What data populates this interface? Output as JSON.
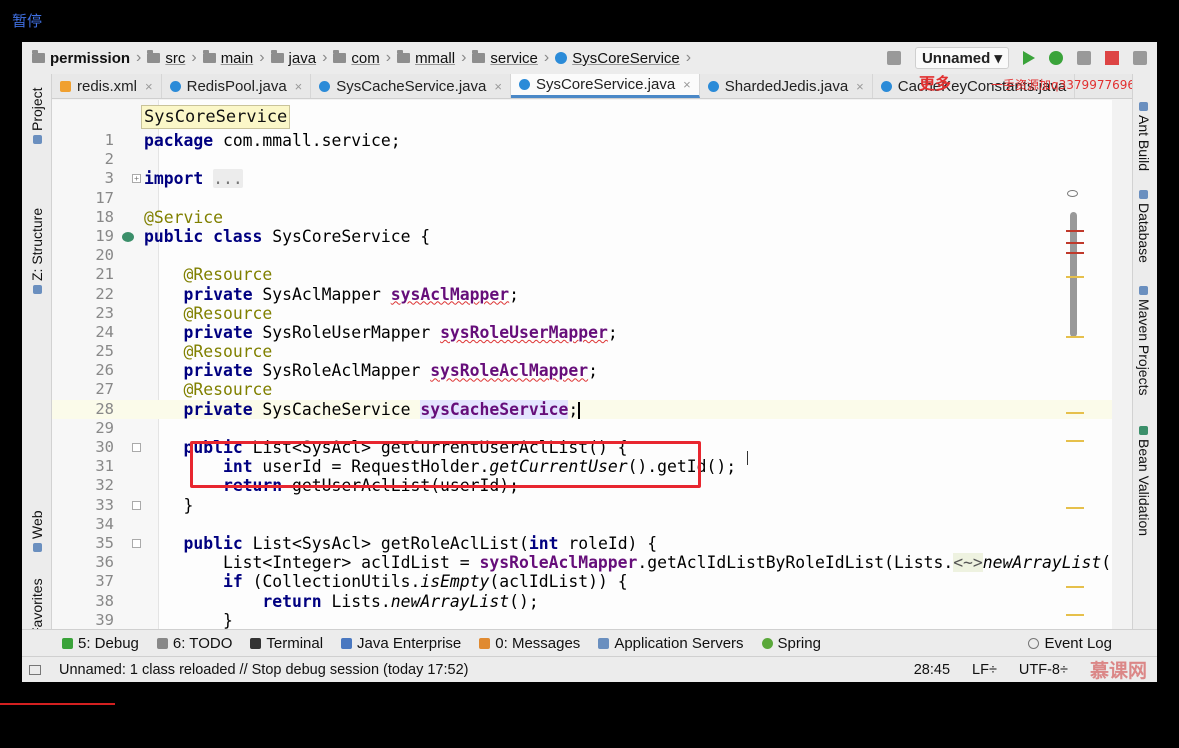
{
  "overlay": {
    "pause_label": "暂停"
  },
  "breadcrumb": [
    {
      "label": "permission",
      "kind": "module"
    },
    {
      "label": "src",
      "kind": "folder"
    },
    {
      "label": "main",
      "kind": "folder"
    },
    {
      "label": "java",
      "kind": "folder"
    },
    {
      "label": "com",
      "kind": "folder"
    },
    {
      "label": "mmall",
      "kind": "folder"
    },
    {
      "label": "service",
      "kind": "folder"
    },
    {
      "label": "SysCoreService",
      "kind": "class"
    }
  ],
  "run_config": {
    "label": "Unnamed"
  },
  "tabs": [
    {
      "label": "redis.xml",
      "active": false
    },
    {
      "label": "RedisPool.java",
      "active": false
    },
    {
      "label": "SysCacheService.java",
      "active": false
    },
    {
      "label": "SysCoreService.java",
      "active": true
    },
    {
      "label": "ShardedJedis.java",
      "active": false
    },
    {
      "label": "CacheKeyConstants.java",
      "active": false
    }
  ],
  "watermark": {
    "big": "更多",
    "text": "一手资源加q3379977696"
  },
  "left_tools": {
    "project": "Project",
    "structure": "Z: Structure",
    "web": "Web",
    "favorites": "Favorites"
  },
  "right_tools": {
    "ant": "Ant Build",
    "database": "Database",
    "maven": "Maven Projects",
    "bean": "Bean Validation"
  },
  "editor": {
    "scope_tip": "SysCoreService",
    "line_numbers": [
      "1",
      "2",
      "3",
      "17",
      "18",
      "19",
      "20",
      "21",
      "22",
      "23",
      "24",
      "25",
      "26",
      "27",
      "28",
      "29",
      "30",
      "31",
      "32",
      "33",
      "34",
      "35",
      "36",
      "37",
      "38",
      "39"
    ]
  },
  "bottom_tools": [
    {
      "label": "5: Debug"
    },
    {
      "label": "6: TODO"
    },
    {
      "label": "Terminal"
    },
    {
      "label": "Java Enterprise"
    },
    {
      "label": "0: Messages"
    },
    {
      "label": "Application Servers"
    },
    {
      "label": "Spring"
    }
  ],
  "event_log": "Event Log",
  "status": {
    "message": "Unnamed: 1 class reloaded // Stop debug session (today 17:52)",
    "position": "28:45",
    "line_sep": "LF",
    "encoding": "UTF-8",
    "logo": "慕课网"
  },
  "colors": {
    "highlight_box": "#e8262f",
    "keyword": "#000080",
    "annotation": "#808000",
    "field": "#660e7a"
  }
}
